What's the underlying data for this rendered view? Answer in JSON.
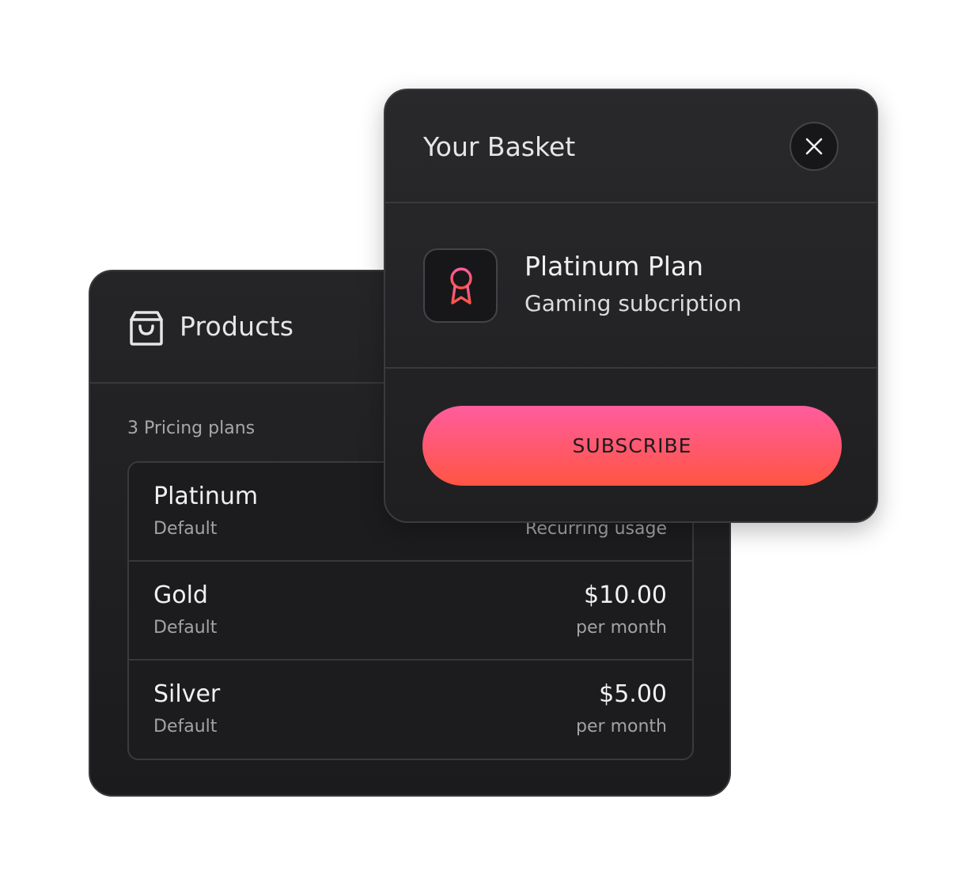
{
  "products": {
    "title": "Products",
    "icon": "shopping-bag-icon",
    "plans_count_label": "3 Pricing plans",
    "plans": [
      {
        "name": "Platinum",
        "subtitle": "Default",
        "price": "",
        "period": "Recurring usage"
      },
      {
        "name": "Gold",
        "subtitle": "Default",
        "price": "$10.00",
        "period": "per month"
      },
      {
        "name": "Silver",
        "subtitle": "Default",
        "price": "$5.00",
        "period": "per month"
      }
    ]
  },
  "basket": {
    "title": "Your Basket",
    "close_icon": "close-icon",
    "item": {
      "icon": "award-ribbon-icon",
      "name": "Platinum Plan",
      "description": "Gaming subcription"
    },
    "subscribe_label": "SUBSCRIBE"
  },
  "colors": {
    "panel_background": "#1c1c1e",
    "accent_gradient_top": "#ff5c9e",
    "accent_gradient_bottom": "#ff5542",
    "text_primary": "#f0f0f0",
    "text_secondary": "#a3a3a6"
  }
}
